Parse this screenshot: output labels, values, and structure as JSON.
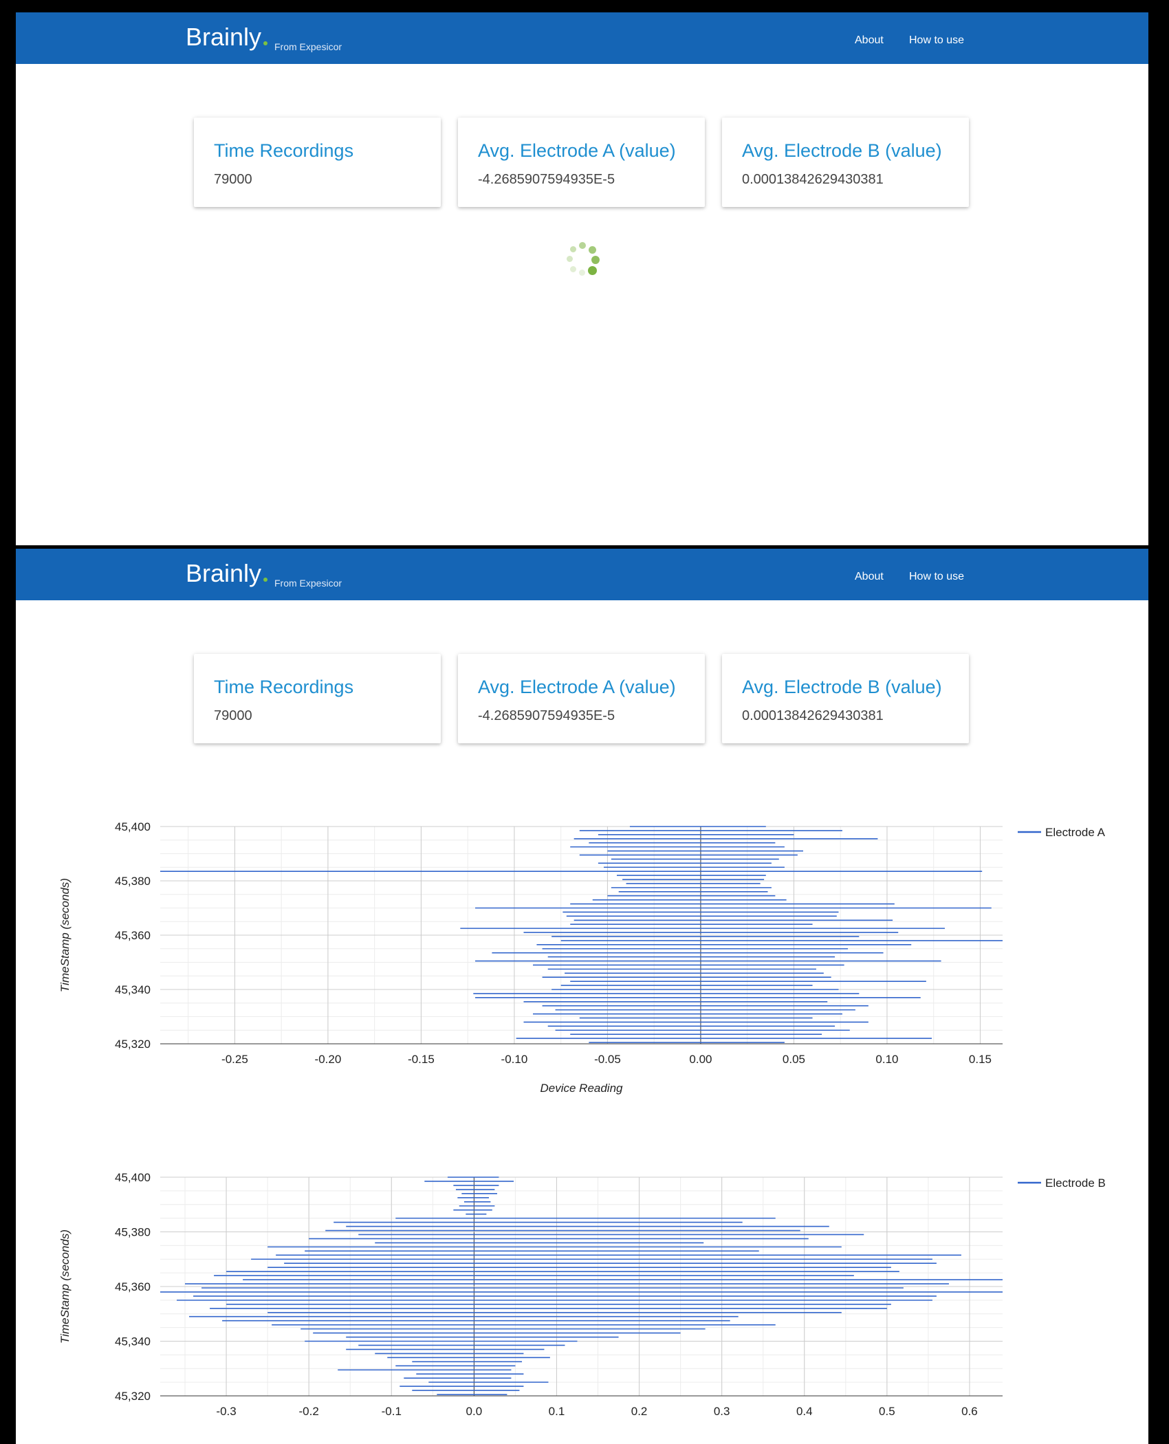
{
  "brand": {
    "name": "Brainly",
    "sub": "From Expesicor"
  },
  "nav": {
    "about": "About",
    "how_to_use": "How to use"
  },
  "cards": [
    {
      "title": "Time Recordings",
      "value": "79000"
    },
    {
      "title": "Avg. Electrode A (value)",
      "value": "-4.2685907594935E-5"
    },
    {
      "title": "Avg. Electrode B (value)",
      "value": "0.00013842629430381"
    }
  ],
  "colors": {
    "navbar": "#1565b5",
    "accent": "#1f8fd0",
    "series": "#3366cc",
    "spinner": "#7cb342"
  },
  "icons": {
    "loading": "loading-spinner-icon"
  },
  "chart_data": [
    {
      "type": "line",
      "series": [
        {
          "name": "Electrode A"
        }
      ],
      "xlabel": "Device Reading",
      "ylabel": "TimeStamp (seconds)",
      "xlim": [
        -0.29,
        0.162
      ],
      "ylim": [
        45320,
        45400
      ],
      "x_ticks": [
        "-0.25",
        "-0.20",
        "-0.15",
        "-0.10",
        "-0.05",
        "0.00",
        "0.05",
        "0.10",
        "0.15"
      ],
      "y_ticks": [
        "45,400",
        "45,380",
        "45,360",
        "45,340",
        "45,320"
      ],
      "grid": true,
      "legend_position": "right",
      "segments": [
        {
          "y": 45400,
          "x0": -0.038,
          "x1": 0.035
        },
        {
          "y": 45398.5,
          "x0": -0.065,
          "x1": 0.076
        },
        {
          "y": 45397,
          "x0": -0.055,
          "x1": 0.05
        },
        {
          "y": 45395.5,
          "x0": -0.068,
          "x1": 0.095
        },
        {
          "y": 45394,
          "x0": -0.06,
          "x1": 0.04
        },
        {
          "y": 45392.5,
          "x0": -0.07,
          "x1": 0.045
        },
        {
          "y": 45391,
          "x0": -0.05,
          "x1": 0.055
        },
        {
          "y": 45389.5,
          "x0": -0.065,
          "x1": 0.052
        },
        {
          "y": 45388,
          "x0": -0.048,
          "x1": 0.042
        },
        {
          "y": 45386.5,
          "x0": -0.055,
          "x1": 0.038
        },
        {
          "y": 45385,
          "x0": -0.052,
          "x1": 0.045
        },
        {
          "y": 45383.5,
          "x0": -0.29,
          "x1": 0.151
        },
        {
          "y": 45382,
          "x0": -0.045,
          "x1": 0.035
        },
        {
          "y": 45380.5,
          "x0": -0.042,
          "x1": 0.034
        },
        {
          "y": 45379,
          "x0": -0.04,
          "x1": 0.032
        },
        {
          "y": 45377.5,
          "x0": -0.048,
          "x1": 0.038
        },
        {
          "y": 45376,
          "x0": -0.044,
          "x1": 0.036
        },
        {
          "y": 45374.5,
          "x0": -0.05,
          "x1": 0.04
        },
        {
          "y": 45373,
          "x0": -0.058,
          "x1": 0.046
        },
        {
          "y": 45371.5,
          "x0": -0.07,
          "x1": 0.104
        },
        {
          "y": 45370,
          "x0": -0.121,
          "x1": 0.156
        },
        {
          "y": 45368.5,
          "x0": -0.074,
          "x1": 0.074
        },
        {
          "y": 45367,
          "x0": -0.072,
          "x1": 0.073
        },
        {
          "y": 45365.5,
          "x0": -0.068,
          "x1": 0.103
        },
        {
          "y": 45364,
          "x0": -0.07,
          "x1": 0.06
        },
        {
          "y": 45362.5,
          "x0": -0.129,
          "x1": 0.131
        },
        {
          "y": 45361,
          "x0": -0.095,
          "x1": 0.106
        },
        {
          "y": 45359.5,
          "x0": -0.08,
          "x1": 0.085
        },
        {
          "y": 45358,
          "x0": -0.075,
          "x1": 0.163
        },
        {
          "y": 45356.5,
          "x0": -0.088,
          "x1": 0.113
        },
        {
          "y": 45355,
          "x0": -0.085,
          "x1": 0.079
        },
        {
          "y": 45353.5,
          "x0": -0.112,
          "x1": 0.098
        },
        {
          "y": 45352,
          "x0": -0.082,
          "x1": 0.072
        },
        {
          "y": 45350.5,
          "x0": -0.121,
          "x1": 0.129
        },
        {
          "y": 45349,
          "x0": -0.09,
          "x1": 0.077
        },
        {
          "y": 45347.5,
          "x0": -0.082,
          "x1": 0.062
        },
        {
          "y": 45346,
          "x0": -0.073,
          "x1": 0.066
        },
        {
          "y": 45344.5,
          "x0": -0.085,
          "x1": 0.07
        },
        {
          "y": 45343,
          "x0": -0.07,
          "x1": 0.121
        },
        {
          "y": 45341.5,
          "x0": -0.075,
          "x1": 0.06
        },
        {
          "y": 45340,
          "x0": -0.08,
          "x1": 0.074
        },
        {
          "y": 45338.5,
          "x0": -0.122,
          "x1": 0.085
        },
        {
          "y": 45337,
          "x0": -0.121,
          "x1": 0.118
        },
        {
          "y": 45335.5,
          "x0": -0.095,
          "x1": 0.068
        },
        {
          "y": 45334,
          "x0": -0.085,
          "x1": 0.09
        },
        {
          "y": 45332.5,
          "x0": -0.078,
          "x1": 0.083
        },
        {
          "y": 45331,
          "x0": -0.09,
          "x1": 0.076
        },
        {
          "y": 45329.5,
          "x0": -0.065,
          "x1": 0.06
        },
        {
          "y": 45328,
          "x0": -0.095,
          "x1": 0.09
        },
        {
          "y": 45326.5,
          "x0": -0.082,
          "x1": 0.072
        },
        {
          "y": 45325,
          "x0": -0.078,
          "x1": 0.08
        },
        {
          "y": 45323.5,
          "x0": -0.07,
          "x1": 0.065
        },
        {
          "y": 45322,
          "x0": -0.099,
          "x1": 0.124
        },
        {
          "y": 45320.5,
          "x0": -0.06,
          "x1": 0.045
        }
      ]
    },
    {
      "type": "line",
      "series": [
        {
          "name": "Electrode B"
        }
      ],
      "xlabel": "",
      "ylabel": "TimeStamp (seconds)",
      "xlim": [
        -0.38,
        0.64
      ],
      "ylim": [
        45320,
        45400
      ],
      "x_ticks": [
        "-0.3",
        "-0.2",
        "-0.1",
        "0.0",
        "0.1",
        "0.2",
        "0.3",
        "0.4",
        "0.5",
        "0.6"
      ],
      "y_ticks": [
        "45,400",
        "45,380",
        "45,360",
        "45,340",
        "45,320"
      ],
      "grid": true,
      "legend_position": "right",
      "segments": [
        {
          "y": 45400,
          "x0": -0.032,
          "x1": 0.03
        },
        {
          "y": 45398.5,
          "x0": -0.06,
          "x1": 0.048
        },
        {
          "y": 45397,
          "x0": -0.025,
          "x1": 0.03
        },
        {
          "y": 45395.5,
          "x0": -0.022,
          "x1": 0.025
        },
        {
          "y": 45394,
          "x0": -0.015,
          "x1": 0.028
        },
        {
          "y": 45392.5,
          "x0": -0.02,
          "x1": 0.018
        },
        {
          "y": 45391,
          "x0": -0.012,
          "x1": 0.02
        },
        {
          "y": 45389.5,
          "x0": -0.018,
          "x1": 0.025
        },
        {
          "y": 45388,
          "x0": -0.025,
          "x1": 0.022
        },
        {
          "y": 45386.5,
          "x0": -0.01,
          "x1": 0.015
        },
        {
          "y": 45385,
          "x0": -0.095,
          "x1": 0.365
        },
        {
          "y": 45383.5,
          "x0": -0.17,
          "x1": 0.325
        },
        {
          "y": 45382,
          "x0": -0.155,
          "x1": 0.43
        },
        {
          "y": 45380.5,
          "x0": -0.18,
          "x1": 0.395
        },
        {
          "y": 45379,
          "x0": -0.14,
          "x1": 0.472
        },
        {
          "y": 45377.5,
          "x0": -0.2,
          "x1": 0.405
        },
        {
          "y": 45376,
          "x0": -0.12,
          "x1": 0.278
        },
        {
          "y": 45374.5,
          "x0": -0.25,
          "x1": 0.445
        },
        {
          "y": 45373,
          "x0": -0.205,
          "x1": 0.345
        },
        {
          "y": 45371.5,
          "x0": -0.24,
          "x1": 0.59
        },
        {
          "y": 45370,
          "x0": -0.27,
          "x1": 0.555
        },
        {
          "y": 45368.5,
          "x0": -0.23,
          "x1": 0.56
        },
        {
          "y": 45367,
          "x0": -0.25,
          "x1": 0.505
        },
        {
          "y": 45365.5,
          "x0": -0.3,
          "x1": 0.515
        },
        {
          "y": 45364,
          "x0": -0.315,
          "x1": 0.46
        },
        {
          "y": 45362.5,
          "x0": -0.28,
          "x1": 0.64
        },
        {
          "y": 45361,
          "x0": -0.35,
          "x1": 0.575
        },
        {
          "y": 45359.5,
          "x0": -0.33,
          "x1": 0.52
        },
        {
          "y": 45358,
          "x0": -0.38,
          "x1": 0.64
        },
        {
          "y": 45356.5,
          "x0": -0.34,
          "x1": 0.56
        },
        {
          "y": 45355,
          "x0": -0.36,
          "x1": 0.555
        },
        {
          "y": 45353.5,
          "x0": -0.3,
          "x1": 0.505
        },
        {
          "y": 45352,
          "x0": -0.32,
          "x1": 0.5
        },
        {
          "y": 45350.5,
          "x0": -0.25,
          "x1": 0.445
        },
        {
          "y": 45349,
          "x0": -0.345,
          "x1": 0.32
        },
        {
          "y": 45347.5,
          "x0": -0.305,
          "x1": 0.31
        },
        {
          "y": 45346,
          "x0": -0.245,
          "x1": 0.365
        },
        {
          "y": 45344.5,
          "x0": -0.21,
          "x1": 0.28
        },
        {
          "y": 45343,
          "x0": -0.195,
          "x1": 0.25
        },
        {
          "y": 45341.5,
          "x0": -0.155,
          "x1": 0.175
        },
        {
          "y": 45340,
          "x0": -0.205,
          "x1": 0.125
        },
        {
          "y": 45338.5,
          "x0": -0.14,
          "x1": 0.11
        },
        {
          "y": 45337,
          "x0": -0.155,
          "x1": 0.085
        },
        {
          "y": 45335.5,
          "x0": -0.12,
          "x1": 0.06
        },
        {
          "y": 45334,
          "x0": -0.105,
          "x1": 0.092
        },
        {
          "y": 45332.5,
          "x0": -0.075,
          "x1": 0.058
        },
        {
          "y": 45331,
          "x0": -0.095,
          "x1": 0.05
        },
        {
          "y": 45329.5,
          "x0": -0.165,
          "x1": 0.045
        },
        {
          "y": 45328,
          "x0": -0.07,
          "x1": 0.06
        },
        {
          "y": 45326.5,
          "x0": -0.085,
          "x1": 0.045
        },
        {
          "y": 45325,
          "x0": -0.055,
          "x1": 0.09
        },
        {
          "y": 45323.5,
          "x0": -0.09,
          "x1": 0.06
        },
        {
          "y": 45322,
          "x0": -0.075,
          "x1": 0.055
        },
        {
          "y": 45320.5,
          "x0": -0.045,
          "x1": 0.04
        }
      ]
    }
  ]
}
